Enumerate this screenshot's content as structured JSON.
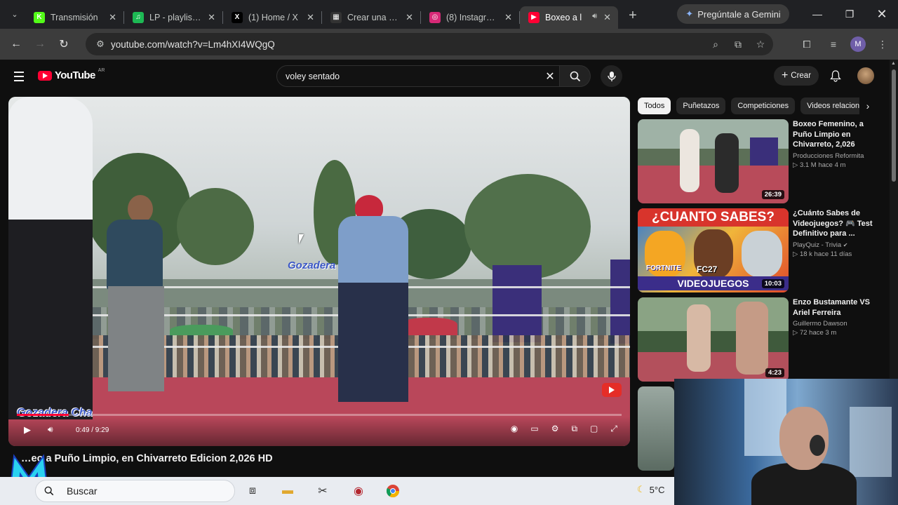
{
  "browser": {
    "tabs": [
      {
        "title": "Transmisión",
        "favicon": "kick-icon",
        "color": "#53fc18",
        "glyph": "K"
      },
      {
        "title": "LP - playlist b",
        "favicon": "spotify-icon",
        "color": "#1db954",
        "glyph": "♫"
      },
      {
        "title": "(1) Home / X",
        "favicon": "x-icon",
        "color": "#000000",
        "glyph": "X"
      },
      {
        "title": "Crear una list",
        "favicon": "sheets-icon",
        "color": "#333333",
        "glyph": "▦"
      },
      {
        "title": "(8) Instagram",
        "favicon": "instagram-icon",
        "color": "#d62976",
        "glyph": "◎"
      },
      {
        "title": "Boxeo a l",
        "favicon": "youtube-icon",
        "color": "#ff0033",
        "glyph": "▶",
        "active": true
      }
    ],
    "gemini_label": "Pregúntale a Gemini",
    "url": "youtube.com/watch?v=Lm4hXI4WQgQ",
    "profile_initial": "M"
  },
  "youtube": {
    "logo_text": "YouTube",
    "country": "AR",
    "search_value": "voley sentado",
    "create_label": "Crear"
  },
  "player": {
    "watermark": "Gozadera",
    "corner_logo": "Gozadera Cha",
    "time": "0:49 / 9:29",
    "progress": 0.086
  },
  "video_title": "…eo a Puño Limpio, en Chivarreto Edicion 2,026 HD",
  "chips": [
    {
      "label": "Todos",
      "active": true
    },
    {
      "label": "Puñetazos"
    },
    {
      "label": "Competiciones"
    },
    {
      "label": "Videos relacionados"
    }
  ],
  "related": [
    {
      "title": "Boxeo Femenino, a Puño Limpio en Chivarreto, 2,026",
      "channel": "Producciones Reformita",
      "meta": "3.1 M  hace 4 m",
      "duration": "26:39"
    },
    {
      "title": "¿Cuánto Sabes de Videojuegos? 🎮 Test Definitivo para ...",
      "channel": "PlayQuiz - Trivia",
      "verified": true,
      "meta": "18 k  hace 11 días",
      "duration": "10:03",
      "thumb_text": "¿CUANTO SABES?",
      "thumb_bottom": "VIDEOJUEGOS",
      "thumb_labels": [
        "FORTNITE",
        "FC27"
      ]
    },
    {
      "title": "Enzo Bustamante VS Ariel Ferreira",
      "channel": "Guillermo Dawson",
      "meta": "72  hace 3 m",
      "duration": "4:23"
    }
  ],
  "taskbar": {
    "search_label": "Buscar",
    "weather": "5°C"
  }
}
